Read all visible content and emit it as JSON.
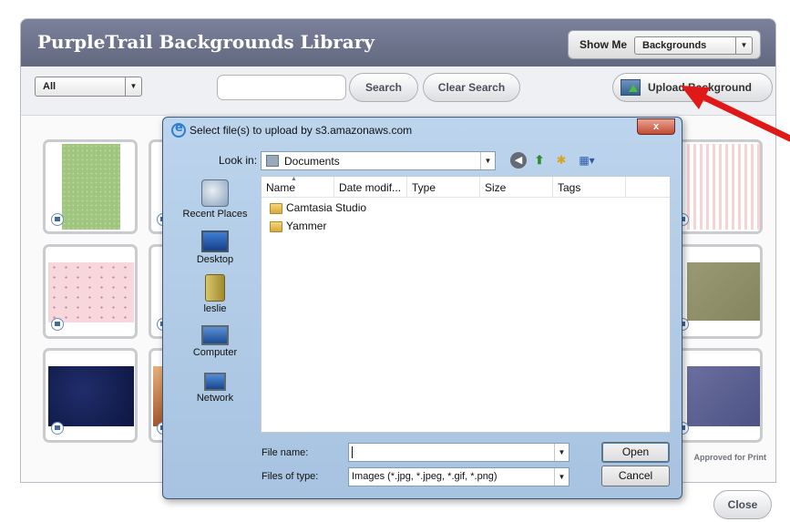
{
  "library": {
    "title": "PurpleTrail Backgrounds Library",
    "show_me_label": "Show Me",
    "show_me_value": "Backgrounds",
    "filter_value": "All",
    "search_placeholder": "",
    "search_button": "Search",
    "clear_button": "Clear Search",
    "upload_button": "Upload Background",
    "approved_label": "Approved for Print",
    "close_button": "Close"
  },
  "dialog": {
    "title": "Select file(s) to upload by s3.amazonaws.com",
    "close_glyph": "x",
    "look_in_label": "Look in:",
    "look_in_value": "Documents",
    "places": [
      "Recent Places",
      "Desktop",
      "leslie",
      "Computer",
      "Network"
    ],
    "columns": [
      "Name",
      "Date modif...",
      "Type",
      "Size",
      "Tags"
    ],
    "files": [
      "Camtasia Studio",
      "Yammer"
    ],
    "file_name_label": "File name:",
    "file_name_value": "",
    "file_type_label": "Files of type:",
    "file_type_value": "Images (*.jpg, *.jpeg, *.gif, *.png)",
    "open_button": "Open",
    "cancel_button": "Cancel"
  },
  "colors": {
    "header": "#6b7189",
    "arrow": "#e01818",
    "dialog_frame": "#b2cbe6"
  }
}
